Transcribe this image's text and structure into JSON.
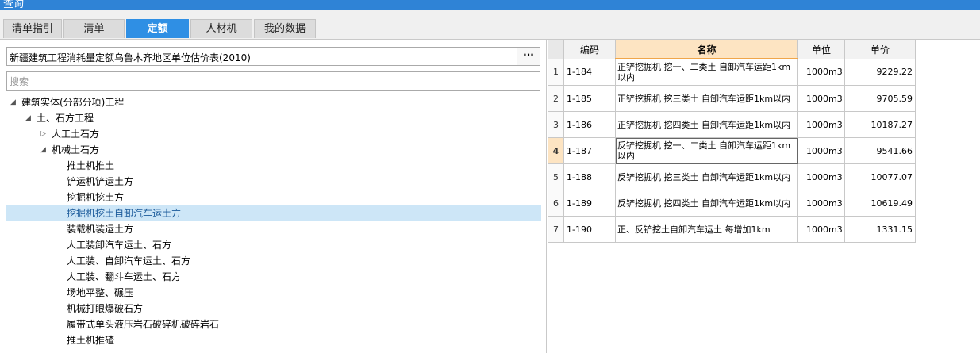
{
  "window": {
    "title": "查询"
  },
  "tabs": [
    {
      "label": "清单指引",
      "active": false
    },
    {
      "label": "清单",
      "active": false
    },
    {
      "label": "定额",
      "active": true
    },
    {
      "label": "人材机",
      "active": false
    },
    {
      "label": "我的数据",
      "active": false
    }
  ],
  "left": {
    "library": {
      "value": "新疆建筑工程消耗量定额乌鲁木齐地区单位估价表(2010)",
      "button": "···"
    },
    "search": {
      "placeholder": "搜索"
    },
    "tree": [
      {
        "label": "建筑实体(分部分项)工程",
        "level": 0,
        "expander": "expanded"
      },
      {
        "label": "土、石方工程",
        "level": 1,
        "expander": "expanded"
      },
      {
        "label": "人工土石方",
        "level": 2,
        "expander": "collapsed"
      },
      {
        "label": "机械土石方",
        "level": 2,
        "expander": "expanded"
      },
      {
        "label": "推土机推土",
        "level": 3,
        "expander": "none"
      },
      {
        "label": "铲运机铲运土方",
        "level": 3,
        "expander": "none"
      },
      {
        "label": "挖掘机挖土方",
        "level": 3,
        "expander": "none"
      },
      {
        "label": "挖掘机挖土自卸汽车运土方",
        "level": 3,
        "expander": "none",
        "selected": true
      },
      {
        "label": "装载机装运土方",
        "level": 3,
        "expander": "none"
      },
      {
        "label": "人工装卸汽车运土、石方",
        "level": 3,
        "expander": "none"
      },
      {
        "label": "人工装、自卸汽车运土、石方",
        "level": 3,
        "expander": "none"
      },
      {
        "label": "人工装、翻斗车运土、石方",
        "level": 3,
        "expander": "none"
      },
      {
        "label": "场地平整、碾压",
        "level": 3,
        "expander": "none"
      },
      {
        "label": "机械打眼爆破石方",
        "level": 3,
        "expander": "none"
      },
      {
        "label": "履带式单头液压岩石破碎机破碎岩石",
        "level": 3,
        "expander": "none"
      },
      {
        "label": "推土机推碴",
        "level": 3,
        "expander": "none"
      }
    ]
  },
  "grid": {
    "columns": [
      "编码",
      "名称",
      "单位",
      "单价"
    ],
    "highlight_column": "名称",
    "current_row": "4",
    "rows": [
      {
        "num": "1",
        "code": "1-184",
        "name": "正铲挖掘机 挖一、二类土 自卸汽车运距1km以内",
        "unit": "1000m3",
        "price": "9229.22"
      },
      {
        "num": "2",
        "code": "1-185",
        "name": "正铲挖掘机 挖三类土 自卸汽车运距1km以内",
        "unit": "1000m3",
        "price": "9705.59"
      },
      {
        "num": "3",
        "code": "1-186",
        "name": "正铲挖掘机 挖四类土 自卸汽车运距1km以内",
        "unit": "1000m3",
        "price": "10187.27"
      },
      {
        "num": "4",
        "code": "1-187",
        "name": "反铲挖掘机 挖一、二类土 自卸汽车运距1km以内",
        "unit": "1000m3",
        "price": "9541.66"
      },
      {
        "num": "5",
        "code": "1-188",
        "name": "反铲挖掘机 挖三类土 自卸汽车运距1km以内",
        "unit": "1000m3",
        "price": "10077.07"
      },
      {
        "num": "6",
        "code": "1-189",
        "name": "反铲挖掘机 挖四类土 自卸汽车运距1km以内",
        "unit": "1000m3",
        "price": "10619.49"
      },
      {
        "num": "7",
        "code": "1-190",
        "name": "正、反铲挖土自卸汽车运土 每增加1km",
        "unit": "1000m3",
        "price": "1331.15"
      }
    ]
  }
}
